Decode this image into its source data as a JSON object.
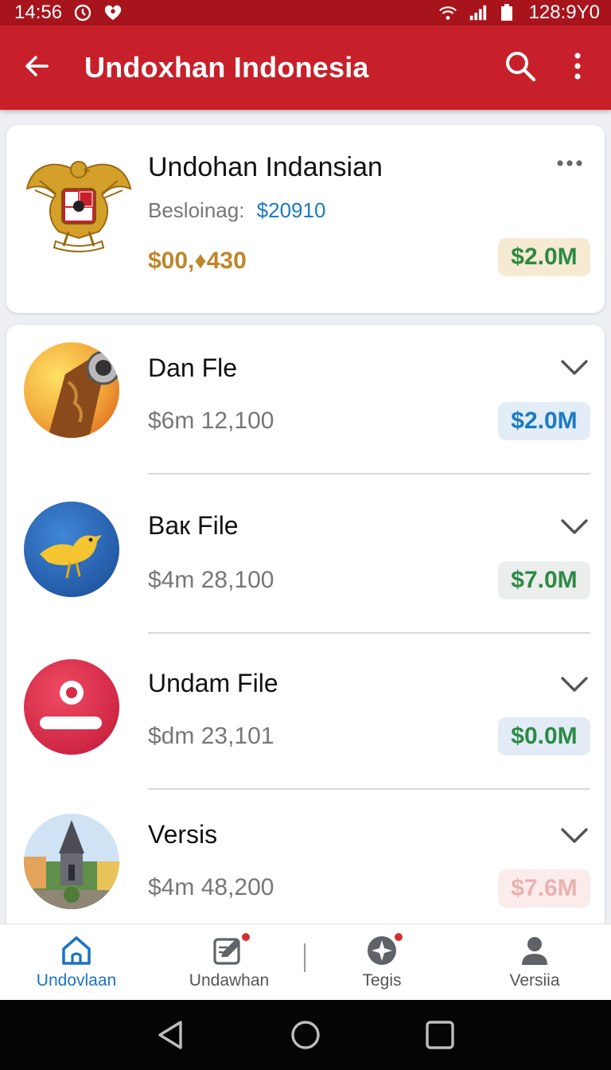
{
  "status_bar": {
    "time": "14:56",
    "right_text": "128:9Y0",
    "icons": [
      "alarm-icon",
      "heart-icon",
      "wifi-icon",
      "signal-icon",
      "battery-icon"
    ]
  },
  "app_bar": {
    "title": "Undoxhan Indonesia",
    "icons": [
      "back-arrow-icon",
      "search-icon",
      "more-vertical-icon"
    ]
  },
  "featured": {
    "title": "Undohan Indansian",
    "meta_label": "Besloinag:",
    "meta_value": "$20910",
    "amount": "$00,♦430",
    "badge": "$2.0M",
    "icons": [
      "garuda-emblem",
      "more-horizontal-icon"
    ]
  },
  "items": [
    {
      "title": "Dan Fle",
      "value": "$6m 12,100",
      "badge": "$2.0M",
      "avatar": "speaker-avatar"
    },
    {
      "title": "Bак File",
      "value": "$4m 28,100",
      "badge": "$7.0M",
      "avatar": "bird-avatar"
    },
    {
      "title": "Undam File",
      "value": "$dm 23,101",
      "badge": "$0.0M",
      "avatar": "user-avatar"
    },
    {
      "title": "Versis",
      "value": "$4m 48,200",
      "badge": "$7.6M",
      "avatar": "temple-avatar"
    }
  ],
  "bottom_nav": [
    {
      "label": "Undovlaan",
      "icon": "home-icon",
      "active": true
    },
    {
      "label": "Undawhan",
      "icon": "edit-icon",
      "badge": true
    },
    {
      "label": "Tegis",
      "icon": "sparkle-icon",
      "badge": true
    },
    {
      "label": "Versiia",
      "icon": "person-icon"
    }
  ],
  "colors": {
    "brand_red": "#c8202a",
    "status_red": "#a8141c",
    "accent_blue": "#1b7ac4",
    "money_green": "#2d8a45",
    "gold": "#c0862a"
  }
}
